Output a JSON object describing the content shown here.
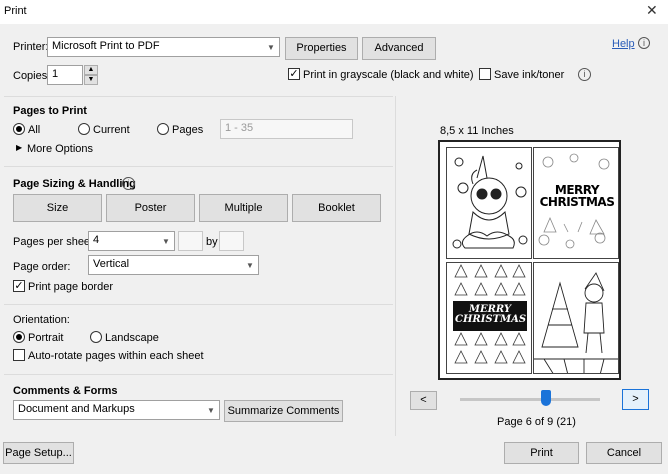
{
  "window": {
    "title": "Print",
    "close_glyph": "✕"
  },
  "printer": {
    "label": "Printer:",
    "value": "Microsoft Print to PDF",
    "properties_label": "Properties",
    "advanced_label": "Advanced",
    "help_label": "Help"
  },
  "copies": {
    "label": "Copies:",
    "value": "1",
    "grayscale_label": "Print in grayscale (black and white)",
    "grayscale_checked": true,
    "save_ink_label": "Save ink/toner",
    "save_ink_checked": false
  },
  "pages_to_print": {
    "title": "Pages to Print",
    "all_label": "All",
    "current_label": "Current",
    "pages_label": "Pages",
    "pages_placeholder": "1 - 35",
    "selected": "all",
    "more_options_label": "More Options"
  },
  "sizing": {
    "title": "Page Sizing & Handling",
    "tabs": [
      "Size",
      "Poster",
      "Multiple",
      "Booklet"
    ],
    "pages_per_sheet_label": "Pages per sheet:",
    "pages_per_sheet_value": "4",
    "by_label": "by",
    "page_order_label": "Page order:",
    "page_order_value": "Vertical",
    "print_border_label": "Print page border",
    "print_border_checked": true
  },
  "orientation": {
    "title": "Orientation:",
    "portrait_label": "Portrait",
    "landscape_label": "Landscape",
    "selected": "portrait",
    "auto_rotate_label": "Auto-rotate pages within each sheet",
    "auto_rotate_checked": false
  },
  "comments": {
    "title": "Comments & Forms",
    "value": "Document and Markups",
    "summarize_label": "Summarize Comments"
  },
  "preview": {
    "paper_size": "8,5 x 11 Inches",
    "page_indicator": "Page 6 of 9 (21)",
    "page_fraction": 0.625,
    "thumb1_text": "MERRY\nCHRISTMAS",
    "thumb2_text": "MERRY\nCHRISTMAS",
    "prev_label": "<",
    "next_label": ">"
  },
  "footer": {
    "page_setup_label": "Page Setup...",
    "print_label": "Print",
    "cancel_label": "Cancel"
  },
  "icons": [
    "info-icon",
    "spin-up-icon",
    "spin-down-icon",
    "chevron-down-icon",
    "triangle-right-icon"
  ],
  "colors": {
    "accent": "#1a73d9",
    "help_link": "#2a5cb8"
  }
}
